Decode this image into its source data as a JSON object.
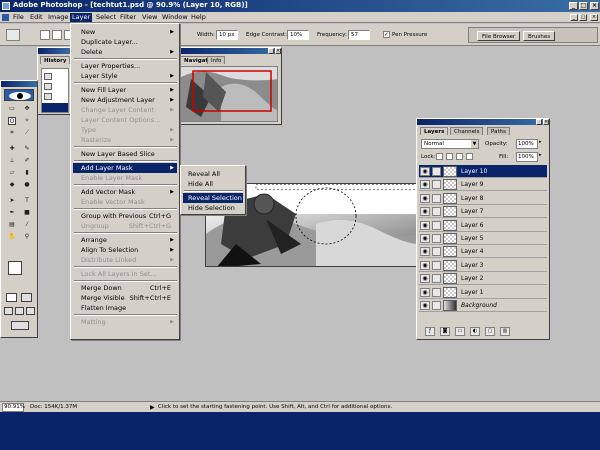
{
  "window": {
    "title": "Adobe Photoshop - [techtut1.psd @ 90.9% (Layer 10, RGB)]",
    "controls": [
      "_",
      "□",
      "×"
    ]
  },
  "menubar": {
    "items": [
      "File",
      "Edit",
      "Image",
      "Layer",
      "Select",
      "Filter",
      "View",
      "Window",
      "Help"
    ],
    "active": "Layer",
    "doc_controls": [
      "_",
      "□",
      "×"
    ]
  },
  "options_bar": {
    "width_label": "Width:",
    "width_value": "10 px",
    "edge_contrast_label": "Edge Contrast:",
    "edge_contrast_value": "10%",
    "frequency_label": "Frequency:",
    "frequency_value": "57",
    "pen_pressure_label": "Pen Pressure",
    "pen_pressure_checked": "✓",
    "palette_well_tabs": [
      "File Browser",
      "Brushes"
    ]
  },
  "history_palette": {
    "tab": "History"
  },
  "navigator_palette": {
    "tabs": [
      "Navigator",
      "Info"
    ],
    "frame_color": "#cc0000"
  },
  "layer_menu": {
    "items": [
      {
        "label": "New",
        "submenu": true
      },
      {
        "label": "Duplicate Layer..."
      },
      {
        "label": "Delete",
        "submenu": true
      },
      {
        "sep": true
      },
      {
        "label": "Layer Properties..."
      },
      {
        "label": "Layer Style",
        "submenu": true
      },
      {
        "sep": true
      },
      {
        "label": "New Fill Layer",
        "submenu": true
      },
      {
        "label": "New Adjustment Layer",
        "submenu": true
      },
      {
        "label": "Change Layer Content",
        "submenu": true,
        "disabled": true
      },
      {
        "label": "Layer Content Options...",
        "disabled": true
      },
      {
        "label": "Type",
        "submenu": true,
        "disabled": true
      },
      {
        "label": "Rasterize",
        "submenu": true,
        "disabled": true
      },
      {
        "sep": true
      },
      {
        "label": "New Layer Based Slice"
      },
      {
        "sep": true
      },
      {
        "label": "Add Layer Mask",
        "submenu": true,
        "highlight": true
      },
      {
        "label": "Enable Layer Mask",
        "disabled": true
      },
      {
        "sep": true
      },
      {
        "label": "Add Vector Mask",
        "submenu": true
      },
      {
        "label": "Enable Vector Mask",
        "disabled": true
      },
      {
        "sep": true
      },
      {
        "label": "Group with Previous",
        "shortcut": "Ctrl+G"
      },
      {
        "label": "Ungroup",
        "shortcut": "Shift+Ctrl+G",
        "disabled": true
      },
      {
        "sep": true
      },
      {
        "label": "Arrange",
        "submenu": true
      },
      {
        "label": "Align To Selection",
        "submenu": true
      },
      {
        "label": "Distribute Linked",
        "submenu": true,
        "disabled": true
      },
      {
        "sep": true
      },
      {
        "label": "Lock All Layers In Set...",
        "disabled": true
      },
      {
        "sep": true
      },
      {
        "label": "Merge Down",
        "shortcut": "Ctrl+E"
      },
      {
        "label": "Merge Visible",
        "shortcut": "Shift+Ctrl+E"
      },
      {
        "label": "Flatten Image"
      },
      {
        "sep": true
      },
      {
        "label": "Matting",
        "submenu": true,
        "disabled": true
      }
    ]
  },
  "layer_mask_submenu": {
    "items": [
      {
        "label": "Reveal All"
      },
      {
        "label": "Hide All"
      },
      {
        "sep": true
      },
      {
        "label": "Reveal Selection",
        "highlight": true
      },
      {
        "label": "Hide Selection"
      }
    ]
  },
  "layers_palette": {
    "tabs": [
      "Layers",
      "Channels",
      "Paths"
    ],
    "blend_mode": "Normal",
    "opacity_label": "Opacity:",
    "opacity_value": "100%",
    "lock_label": "Lock:",
    "fill_label": "Fill:",
    "fill_value": "100%",
    "layers": [
      {
        "name": "Layer 10",
        "active": true
      },
      {
        "name": "Layer 9"
      },
      {
        "name": "Layer 8"
      },
      {
        "name": "Layer 7"
      },
      {
        "name": "Layer 6"
      },
      {
        "name": "Layer 5"
      },
      {
        "name": "Layer 4"
      },
      {
        "name": "Layer 3"
      },
      {
        "name": "Layer 2"
      },
      {
        "name": "Layer 1"
      },
      {
        "name": "Background",
        "italic": true
      }
    ]
  },
  "status_bar": {
    "zoom": "90.91%",
    "doc_info": "Doc: 154K/1.37M",
    "hint": "Click to set the starting fastening point.  Use Shift, Alt, and Ctrl for additional options."
  }
}
